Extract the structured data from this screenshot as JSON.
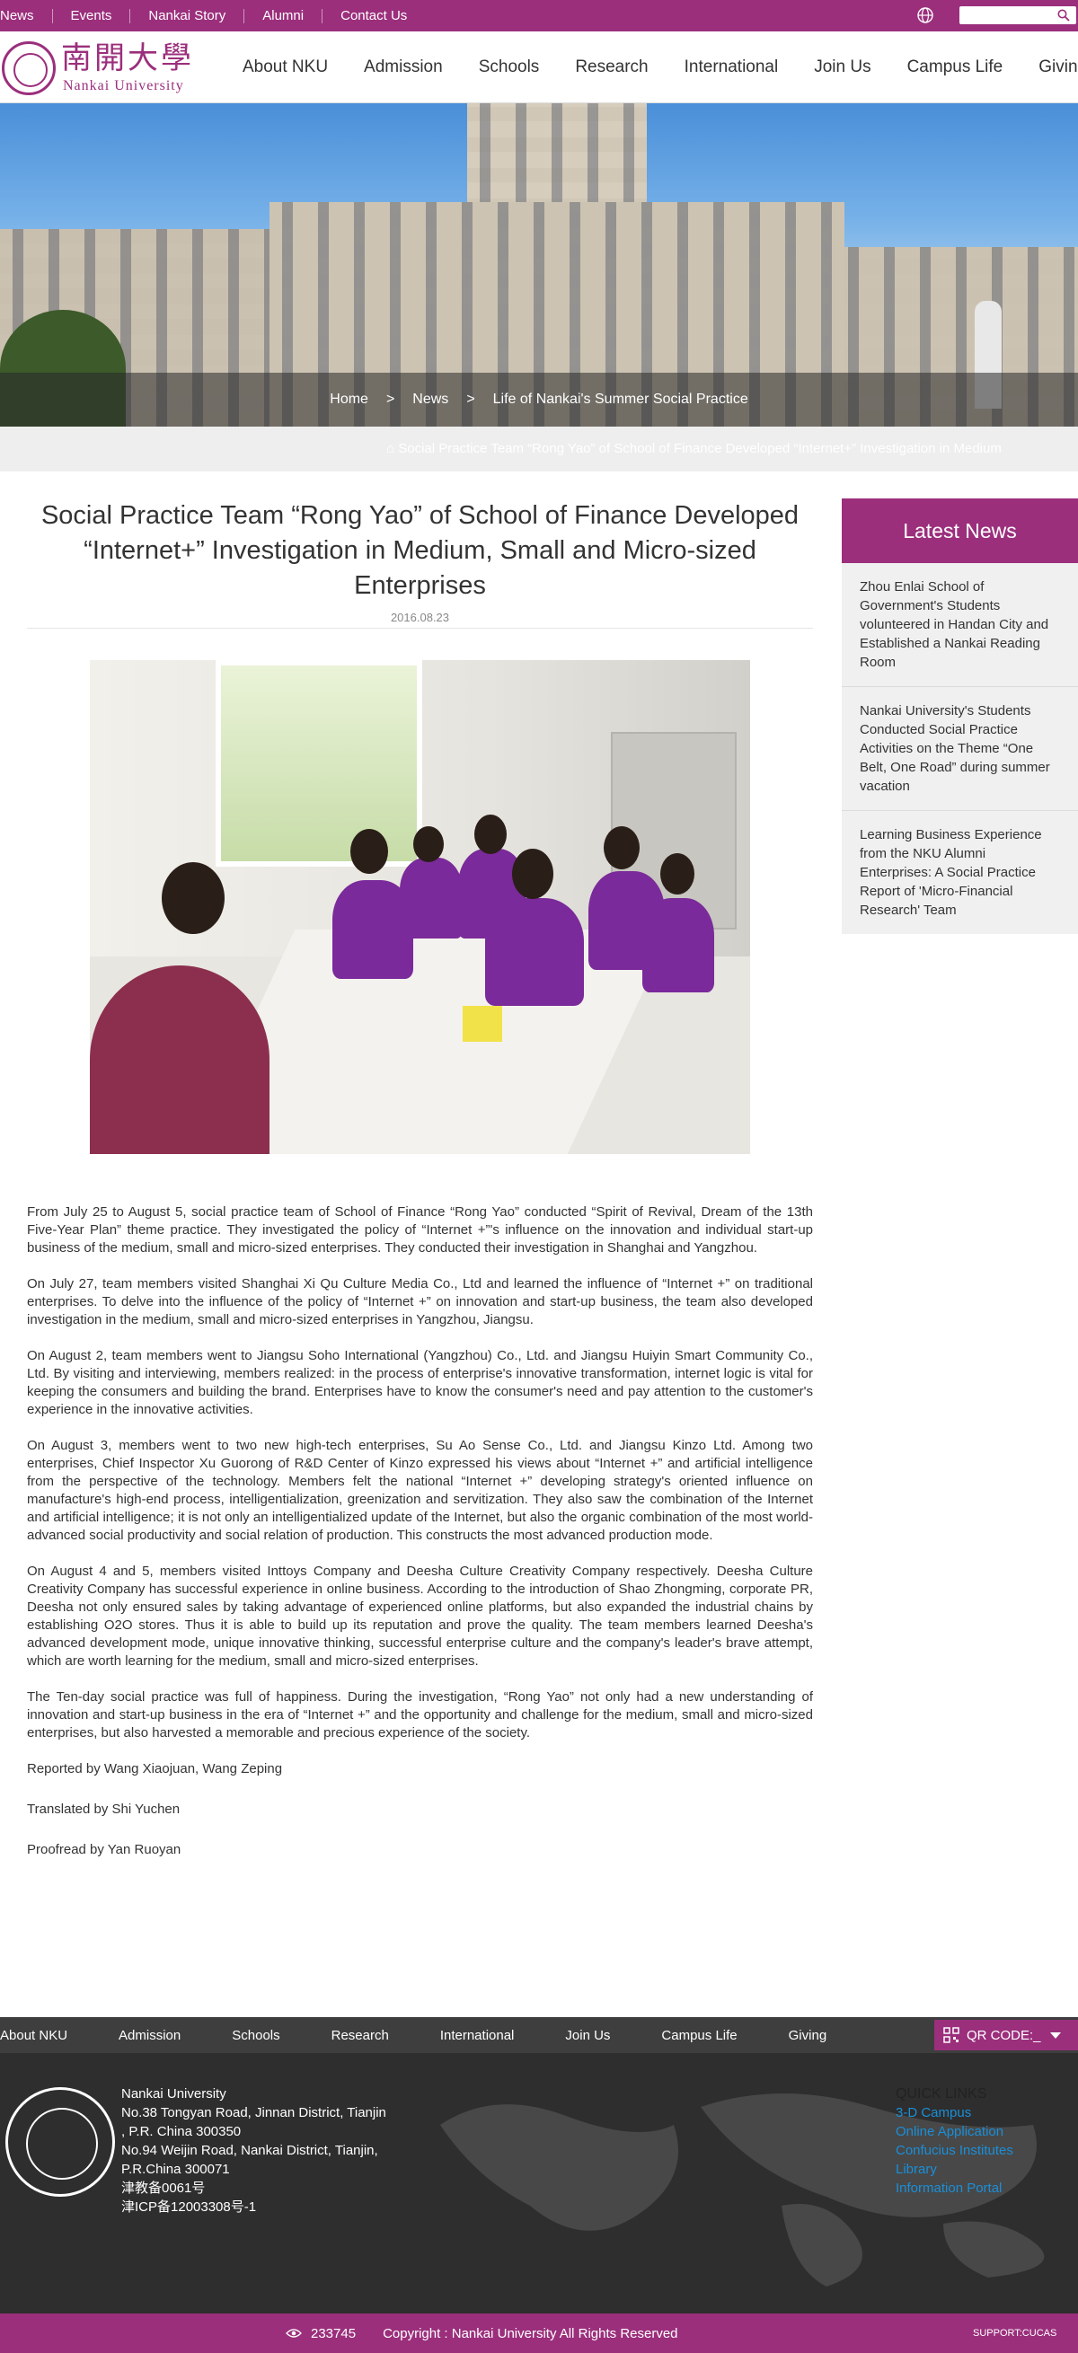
{
  "topbar": {
    "links": [
      "News",
      "Events",
      "Nankai Story",
      "Alumni",
      "Contact Us"
    ],
    "search_placeholder": ""
  },
  "logo": {
    "chinese": "南開大學",
    "english": "Nankai University"
  },
  "nav": [
    "About NKU",
    "Admission",
    "Schools",
    "Research",
    "International",
    "Join Us",
    "Campus Life",
    "Giving"
  ],
  "breadcrumb": {
    "home": "Home",
    "section": "News",
    "current": "Life of Nankai's Summer Social Practice",
    "sep": ">"
  },
  "subcrumb": "⌂  Social Practice Team “Rong Yao” of School of Finance Developed “Internet+” Investigation in Medium",
  "article": {
    "title": "Social Practice Team “Rong Yao” of School of Finance Developed “Internet+” Investigation in Medium, Small and Micro-sized Enterprises",
    "date": "2016.08.23",
    "paragraphs": [
      "From July 25 to August 5, social practice team of School of Finance “Rong Yao” conducted “Spirit of Revival, Dream of the 13th Five-Year Plan” theme practice. They investigated the policy of “Internet +”'s influence on the innovation and individual start-up business of the medium, small and micro-sized enterprises. They conducted their investigation in Shanghai and Yangzhou.",
      "On July 27, team members visited Shanghai Xi Qu Culture Media Co., Ltd and learned the influence of “Internet +” on traditional enterprises. To delve into the influence of the policy of “Internet +” on innovation and start-up business, the team also developed investigation in the medium, small and micro-sized enterprises in Yangzhou, Jiangsu.",
      "On August 2, team members went to Jiangsu Soho International (Yangzhou) Co., Ltd. and Jiangsu Huiyin Smart Community Co., Ltd. By visiting and interviewing, members realized: in the process of enterprise's innovative transformation, internet logic is vital for keeping the consumers and building the brand. Enterprises have to know the consumer's need and pay attention to the customer's experience in the innovative activities.",
      "On August 3, members went to two new high-tech enterprises, Su Ao Sense Co., Ltd. and Jiangsu Kinzo Ltd. Among two enterprises, Chief Inspector Xu Guorong of R&D Center of Kinzo expressed his views about “Internet +” and artificial intelligence from the perspective of the technology. Members felt the national “Internet +” developing strategy's oriented influence on manufacture's high-end process, intelligentialization, greenization and servitization. They also saw the combination of the Internet and artificial intelligence; it is not only an intelligentialized update of the Internet, but also the organic combination of the most world-advanced social productivity and social relation of production. This constructs the most advanced production mode.",
      "On August 4 and 5, members visited Inttoys Company and Deesha Culture Creativity Company respectively. Deesha Culture Creativity Company has successful experience in online business. According to the introduction of Shao Zhongming, corporate PR, Deesha not only ensured sales by taking advantage of experienced online platforms, but also expanded the industrial chains by establishing O2O stores. Thus it is able to build up its reputation and prove the quality. The team members learned Deesha's advanced development mode, unique innovative thinking, successful enterprise culture and the company's leader's brave attempt, which are worth learning for the medium, small and micro-sized enterprises.",
      "The Ten-day social practice was full of happiness. During the investigation, “Rong Yao” not only had a new understanding of innovation and start-up business in the era of “Internet +” and the opportunity and challenge for the medium, small and micro-sized enterprises, but also harvested a memorable and precious experience of the society."
    ],
    "reported": "Reported by Wang Xiaojuan, Wang Zeping",
    "translated": "Translated by Shi Yuchen",
    "proofread": "Proofread by Yan Ruoyan"
  },
  "sidebar": {
    "title": "Latest News",
    "items": [
      "Zhou Enlai School of Government's Students volunteered in Handan City and Established a Nankai Reading Room",
      "Nankai University's Students Conducted Social Practice Activities on the Theme “One Belt, One Road” during summer vacation",
      "Learning Business Experience from the NKU Alumni Enterprises: A Social Practice Report of 'Micro-Financial Research' Team"
    ]
  },
  "footer": {
    "nav": [
      "About NKU",
      "Admission",
      "Schools",
      "Research",
      "International",
      "Join Us",
      "Campus Life",
      "Giving"
    ],
    "qr_label": "QR CODE:_",
    "address_lines": [
      "Nankai University",
      "No.38 Tongyan Road, Jinnan District, Tianjin",
      ", P.R. China 300350",
      "No.94 Weijin Road,  Nankai District, Tianjin,",
      "P.R.China  300071",
      "津教备0061号",
      "津ICP备12003308号-1"
    ],
    "quick_links_title": "QUICK LINKS",
    "quick_links": [
      "3-D Campus",
      "Online Application",
      "Confucius Institutes",
      "Library",
      "Information Portal"
    ],
    "visit_count": "233745",
    "copyright": "Copyright : Nankai University All Rights Reserved",
    "support": "SUPPORT:CUCAS"
  },
  "colors": {
    "brand": "#9b2f7c",
    "link": "#1a8fd8",
    "footer_bg": "#2e2e2e"
  }
}
